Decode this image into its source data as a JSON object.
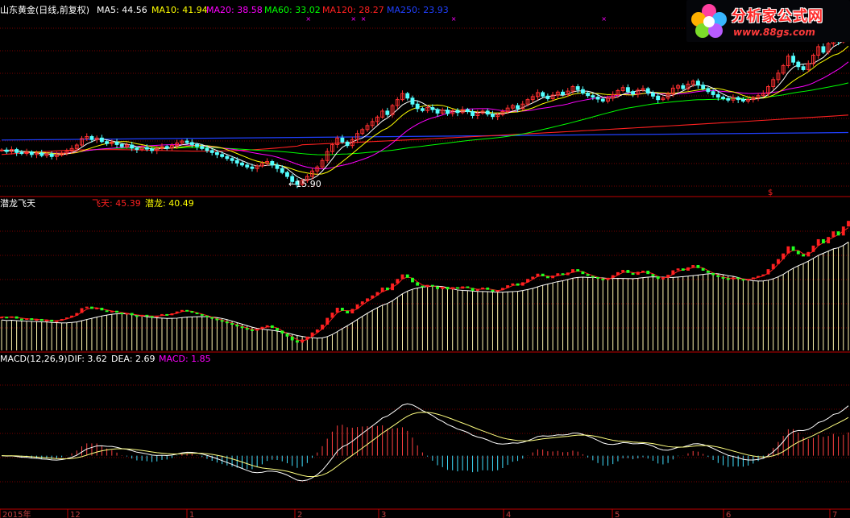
{
  "header": {
    "title": "山东黄金(日线,前复权)",
    "ma": [
      {
        "label": "MA5: 44.56",
        "color": "#ffffff"
      },
      {
        "label": "MA10: 41.94",
        "color": "#ffff00"
      },
      {
        "label": "MA20: 38.58",
        "color": "#ff00ff"
      },
      {
        "label": "MA60: 33.02",
        "color": "#00ff00"
      },
      {
        "label": "MA120: 28.27",
        "color": "#ff2020"
      },
      {
        "label": "MA250: 23.93",
        "color": "#2040ff"
      }
    ]
  },
  "logo": {
    "title": "分析家公式网",
    "url": "www.88gs.com"
  },
  "panel2": {
    "name": "潜龙飞天",
    "feitian": {
      "label": "飞天: 45.39",
      "color": "#ff2020"
    },
    "qianlong": {
      "label": "潜龙: 40.49",
      "color": "#ffff00"
    }
  },
  "panel3": {
    "name": "MACD(12,26,9)",
    "dif": {
      "label": "DIF: 3.62",
      "color": "#ffffff"
    },
    "dea": {
      "label": "DEA: 2.69",
      "color": "#ffffff"
    },
    "macd": {
      "label": "MACD: 1.85",
      "color": "#ff00ff"
    }
  },
  "annotation": {
    "low_label": "←15.90",
    "low_price": 15.9
  },
  "x_axis": {
    "labels": [
      "2015年",
      "12",
      "1",
      "2",
      "3",
      "4",
      "5",
      "6",
      "7"
    ]
  },
  "chart_data": {
    "type": "candlestick",
    "price_range": [
      14.5,
      50
    ],
    "closes": [
      23.5,
      23.2,
      23.6,
      23.0,
      22.8,
      23.1,
      22.6,
      22.9,
      22.4,
      22.7,
      22.2,
      22.5,
      22.9,
      23.3,
      23.8,
      24.5,
      25.8,
      26.2,
      25.6,
      25.9,
      25.2,
      24.8,
      25.1,
      24.6,
      24.2,
      24.5,
      23.9,
      23.6,
      24.0,
      23.7,
      23.4,
      23.8,
      24.2,
      23.9,
      24.4,
      24.9,
      25.3,
      25.0,
      24.6,
      24.2,
      23.8,
      23.4,
      23.0,
      22.6,
      22.2,
      21.8,
      21.4,
      20.9,
      20.5,
      20.1,
      19.8,
      20.3,
      20.8,
      21.2,
      20.5,
      19.8,
      19.0,
      18.2,
      17.2,
      16.6,
      17.4,
      18.2,
      19.3,
      20.1,
      21.4,
      23.2,
      24.6,
      25.9,
      25.1,
      24.4,
      25.6,
      26.8,
      27.6,
      28.4,
      29.2,
      30.1,
      31.3,
      30.6,
      32.4,
      33.6,
      34.8,
      33.9,
      32.7,
      31.8,
      31.4,
      32.0,
      31.6,
      30.9,
      31.5,
      30.8,
      31.4,
      31.0,
      31.6,
      31.2,
      30.4,
      30.9,
      31.3,
      30.7,
      30.2,
      30.6,
      31.2,
      31.9,
      32.4,
      31.8,
      32.7,
      33.6,
      34.2,
      35.0,
      34.3,
      33.8,
      34.5,
      35.1,
      34.6,
      35.3,
      36.2,
      35.6,
      34.9,
      34.4,
      34.1,
      33.7,
      33.3,
      33.9,
      34.6,
      35.4,
      36.0,
      35.2,
      34.7,
      35.5,
      35.8,
      34.9,
      34.3,
      33.6,
      33.9,
      34.7,
      35.9,
      36.4,
      35.8,
      36.7,
      37.3,
      36.5,
      35.8,
      35.2,
      34.6,
      34.1,
      33.8,
      33.5,
      34.0,
      33.6,
      33.3,
      33.6,
      34.0,
      34.4,
      34.8,
      36.2,
      37.6,
      38.9,
      40.4,
      42.3,
      41.1,
      40.2,
      39.6,
      40.8,
      42.5,
      44.2,
      43.1,
      44.8,
      46.3,
      45.2,
      47.6,
      49.1
    ],
    "ma_periods": [
      5,
      10,
      20,
      60,
      120,
      250
    ],
    "ma250_line": [
      25.5,
      27.0
    ],
    "ma120_line": [
      22.6,
      30.5
    ],
    "macd_range": [
      -3.2,
      5.5
    ],
    "last_dif": 3.62,
    "last_dea": 2.69,
    "last_macd": 1.85
  }
}
